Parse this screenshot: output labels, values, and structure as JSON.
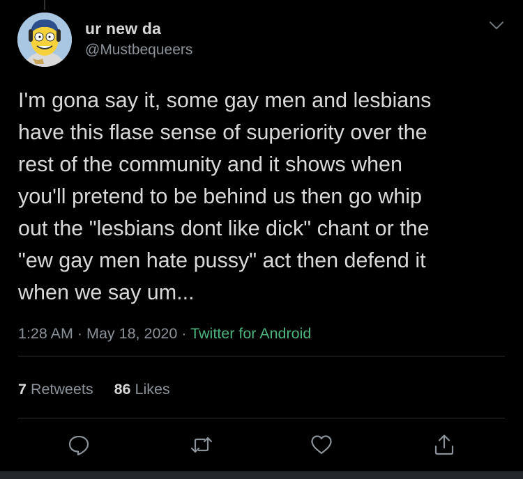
{
  "user": {
    "display_name": "ur new da",
    "handle": "@Mustbequeers"
  },
  "tweet": {
    "text": "I'm gona say it, some gay men and lesbians\nhave this flase sense of superiority over the\nrest of the community and it shows when\nyou'll pretend to be behind us then go whip\nout the \"lesbians dont like dick\" chant or the\n\"ew gay men hate pussy\" act then defend it\nwhen we say um...",
    "time": "1:28 AM",
    "sep1": "·",
    "date": "May 18, 2020",
    "sep2": "·",
    "source": "Twitter for Android"
  },
  "stats": {
    "retweets_count": "7",
    "retweets_label": "Retweets",
    "likes_count": "86",
    "likes_label": "Likes"
  },
  "icons": {
    "reply": "reply-icon",
    "retweet": "retweet-icon",
    "like": "heart-icon",
    "share": "share-icon",
    "more": "chevron-down-icon"
  },
  "colors": {
    "background": "#000000",
    "text": "#d9d9d9",
    "muted": "#8b9299",
    "source": "#4fb380",
    "divider": "#2f3336"
  }
}
